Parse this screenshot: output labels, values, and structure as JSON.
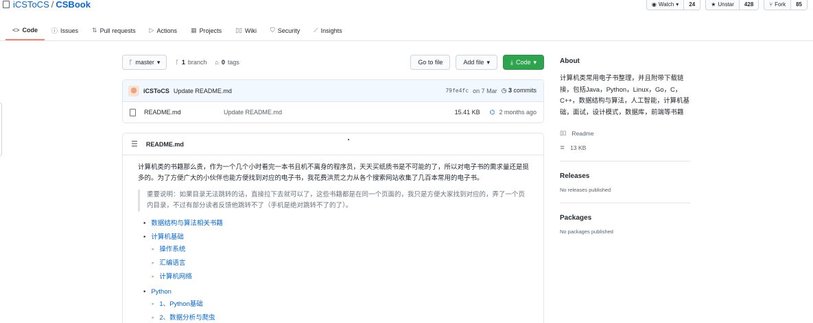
{
  "repo": {
    "owner": "iCSToCS",
    "separator": "/",
    "name": "CSBook"
  },
  "actions": {
    "watch": {
      "label": "Watch",
      "count": "24"
    },
    "unstar": {
      "label": "Unstar",
      "count": "428"
    },
    "fork": {
      "label": "Fork",
      "count": "85"
    }
  },
  "tabs": [
    {
      "icon": "<>",
      "label": "Code"
    },
    {
      "icon": "ⓘ",
      "label": "Issues"
    },
    {
      "icon": "⇅",
      "label": "Pull requests"
    },
    {
      "icon": "▷",
      "label": "Actions"
    },
    {
      "icon": "▦",
      "label": "Projects"
    },
    {
      "icon": "▯▯",
      "label": "Wiki"
    },
    {
      "icon": "⛉",
      "label": "Security"
    },
    {
      "icon": "⟋",
      "label": "Insights"
    }
  ],
  "filenav": {
    "branch": "master",
    "branch_count": "1",
    "branch_label": "branch",
    "tag_count": "0",
    "tag_label": "tags",
    "goto_file": "Go to file",
    "add_file": "Add file",
    "code": "Code"
  },
  "commit": {
    "author": "iCSToCS",
    "message": "Update README.md",
    "sha": "79fe4fc",
    "date": "on 7 Mar",
    "commits_count": "3",
    "commits_label": "commits"
  },
  "files": [
    {
      "name": "README.md",
      "message": "Update README.md",
      "size": "15.41 KB",
      "age": "2 months ago"
    }
  ],
  "readme": {
    "title": "README.md",
    "intro": "计算机类的书籍那么贵，作为一个几个小时看完一本书且机不离身的程序员，天天买纸质书是不可能的了，所以对电子书的需求量还是挺多的。为了方便广大的小伙伴也能方便找到对应的电子书，我花费洪荒之力从各个搜索网站收集了几百本常用的电子书。",
    "note": "重要说明：如果目录无法跳转的话，直接拉下去就可以了，这些书籍都是在同一个页面的，我只是方便大家找到对应的，弄了一个页内目录，不过有部分读者反馈他跳转不了（手机是绝对跳转不了的了）。",
    "toc": [
      {
        "label": "数据结构与算法相关书籍",
        "children": []
      },
      {
        "label": "计算机基础",
        "children": [
          "操作系统",
          "汇编语言",
          "计算机网络"
        ]
      },
      {
        "label": "Python",
        "children": [
          "1、Python基础",
          "2、数据分析与爬虫"
        ]
      }
    ]
  },
  "sidebar": {
    "about_title": "About",
    "about_text": "计算机类常用电子书整理，并且附带下载链接，包括Java，Python，Linux，Go，C，C++，数据结构与算法，人工智能，计算机基础，面试，设计模式，数据库，前端等书籍",
    "readme_label": "Readme",
    "size_label": "13 KB",
    "releases_title": "Releases",
    "releases_empty": "No releases published",
    "packages_title": "Packages",
    "packages_empty": "No packages published"
  },
  "colors": {
    "link": "#0366d6",
    "primary_button": "#2ea44f",
    "active_tab_underline": "#f9826c"
  }
}
